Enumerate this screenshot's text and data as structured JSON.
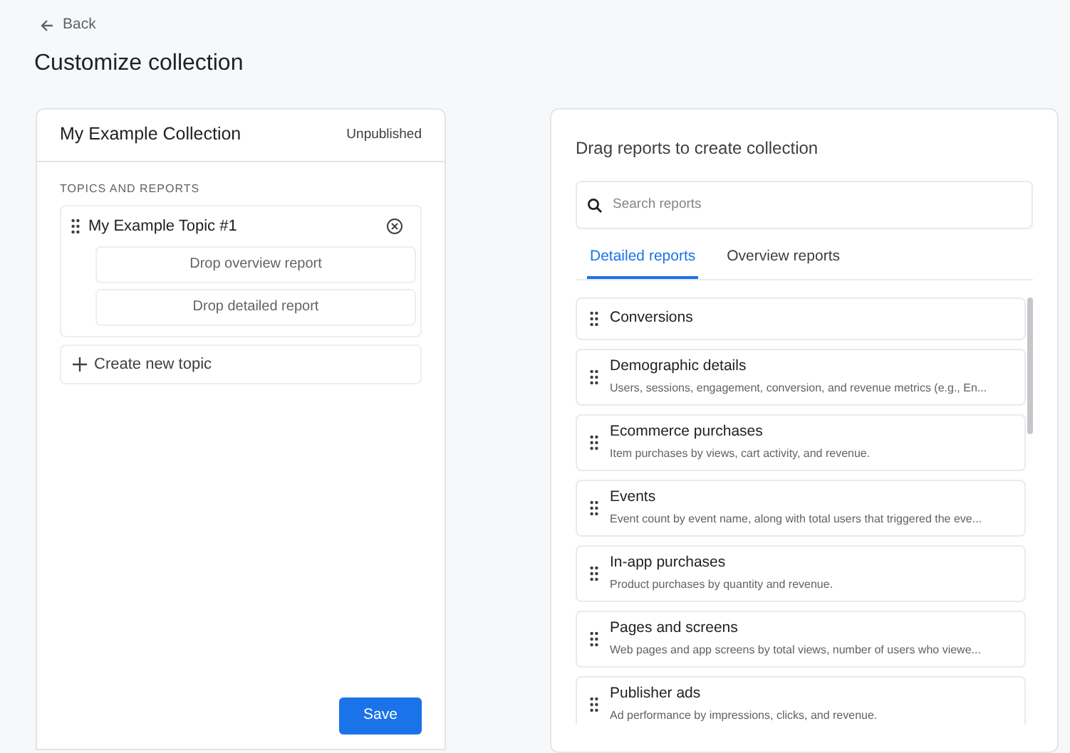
{
  "back_link": "Back",
  "page_title": "Customize collection",
  "collection": {
    "name": "My Example Collection",
    "status": "Unpublished",
    "section_label": "TOPICS AND REPORTS",
    "topics": [
      {
        "name": "My Example Topic #1",
        "slots": [
          "Drop overview report",
          "Drop detailed report"
        ]
      }
    ],
    "create_topic": "Create new topic",
    "save_button": "Save"
  },
  "library": {
    "title": "Drag reports to create collection",
    "search": {
      "placeholder": "Search reports"
    },
    "tabs": [
      {
        "label": "Detailed reports",
        "selected": true
      },
      {
        "label": "Overview reports",
        "selected": false
      }
    ],
    "reports": [
      {
        "title": "Conversions"
      },
      {
        "title": "Demographic details",
        "description": "Users, sessions, engagement, conversion, and revenue metrics (e.g., En..."
      },
      {
        "title": "Ecommerce purchases",
        "description": "Item purchases by views, cart activity, and revenue."
      },
      {
        "title": "Events",
        "description": "Event count by event name, along with total users that triggered the eve..."
      },
      {
        "title": "In-app purchases",
        "description": "Product purchases by quantity and revenue."
      },
      {
        "title": "Pages and screens",
        "description": "Web pages and app screens by total views, number of users who viewe..."
      },
      {
        "title": "Publisher ads",
        "description": "Ad performance by impressions, clicks, and revenue."
      }
    ]
  }
}
